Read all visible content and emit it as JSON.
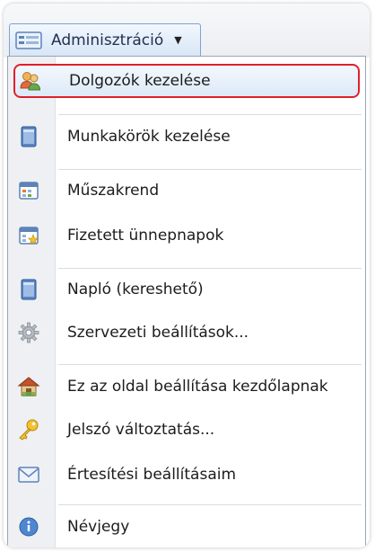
{
  "menu": {
    "title": "Adminisztráció",
    "caret_icon": "caret-down-icon",
    "icon": "admin-panel-icon"
  },
  "items": [
    {
      "label": "Dolgozók kezelése",
      "icon": "users-icon",
      "selected": true
    },
    {
      "label": "Munkakörök kezelése",
      "icon": "document-icon"
    },
    {
      "label": "Műszakrend",
      "icon": "calendar-icon"
    },
    {
      "label": "Fizetett ünnepnapok",
      "icon": "calendar-star-icon"
    },
    {
      "label": "Napló (kereshető)",
      "icon": "log-book-icon"
    },
    {
      "label": "Szervezeti beállítások...",
      "icon": "gear-icon"
    },
    {
      "label": "Ez az oldal beállítása kezdőlapnak",
      "icon": "home-icon"
    },
    {
      "label": "Jelszó változtatás...",
      "icon": "key-icon"
    },
    {
      "label": "Értesítési beállításaim",
      "icon": "envelope-icon"
    },
    {
      "label": "Névjegy",
      "icon": "info-icon"
    }
  ],
  "colors": {
    "selection_border": "#e0202c",
    "selection_fill": "#dde9f8",
    "gutter": "#eef0f3"
  }
}
